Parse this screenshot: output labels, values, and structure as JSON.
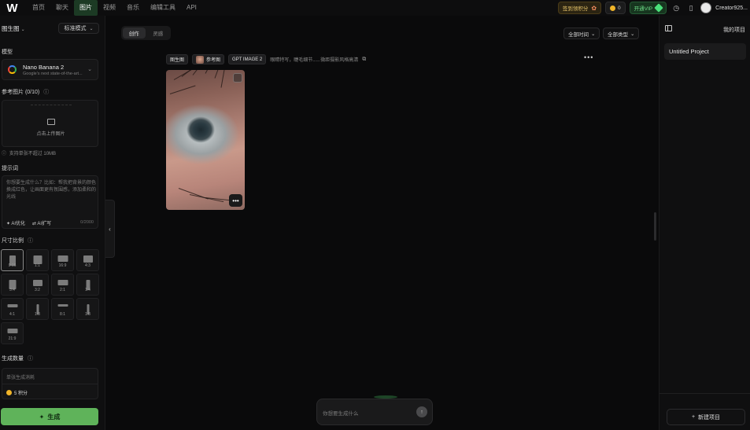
{
  "app": {
    "logo": "W"
  },
  "nav": {
    "items": [
      {
        "label": "首页"
      },
      {
        "label": "聊天"
      },
      {
        "label": "图片",
        "active": true
      },
      {
        "label": "视频"
      },
      {
        "label": "音乐"
      },
      {
        "label": "编辑工具"
      },
      {
        "label": "API"
      }
    ]
  },
  "topbar": {
    "promo_label": "签到领积分",
    "credits": "0",
    "vip_label": "开通VIP",
    "username": "Creator925..."
  },
  "left": {
    "mode_label": "图生图",
    "style_label": "标准模式",
    "model_section_label": "模型",
    "model_name": "Nano Banana 2",
    "model_sub": "Google's next state-of-the-art...",
    "ref_section_label": "参考图片 (0/10)",
    "upload_text": "点击上传图片",
    "upload_hint": "支持单张不超过 10MB",
    "prompt_section_label": "提示词",
    "prompt_placeholder": "你想要生成什么？比如：帮我把背景的颜色换成红色，让画面更有氛围感，添加柔和的光线",
    "prompt_tool_1": "AI优化",
    "prompt_tool_2": "AI扩写",
    "prompt_counter": "0/2000",
    "ratio_section_label": "尺寸比例",
    "ratios": [
      {
        "label": "9:16",
        "selected": true,
        "w": 8,
        "h": 13
      },
      {
        "label": "1:1",
        "w": 11,
        "h": 11
      },
      {
        "label": "16:9",
        "w": 13,
        "h": 8
      },
      {
        "label": "4:3",
        "w": 12,
        "h": 9
      },
      {
        "label": "3:4",
        "w": 9,
        "h": 12
      },
      {
        "label": "3:2",
        "w": 12,
        "h": 8
      },
      {
        "label": "2:1",
        "w": 13,
        "h": 7
      },
      {
        "label": "1:4",
        "w": 5,
        "h": 13
      },
      {
        "label": "4:1",
        "w": 13,
        "h": 4
      },
      {
        "label": "1:8",
        "w": 3,
        "h": 13
      },
      {
        "label": "8:1",
        "w": 13,
        "h": 3
      },
      {
        "label": "1:8",
        "w": 3,
        "h": 13
      },
      {
        "label": "21:9",
        "w": 13,
        "h": 6
      }
    ],
    "count_section_label": "生成数量",
    "count_placeholder": "单张生成消耗",
    "cost_label": "5 积分",
    "generate_label": "生成"
  },
  "center": {
    "segments": [
      {
        "label": "创作",
        "active": true
      },
      {
        "label": "灵感"
      }
    ],
    "filter_time": "全部时间",
    "filter_type": "全部类型",
    "result_tags": {
      "mode": "图生图",
      "ref": "参考图",
      "model": "GPT IMAGE 2"
    },
    "result_prompt": "眼睛特写，睫毛细节......微距摄影风格高清",
    "more_label": "•••",
    "chat_placeholder": "你想要生成什么"
  },
  "right": {
    "title": "我的项目",
    "project_name": "Untitled Project",
    "new_project_label": "新建项目"
  },
  "colors": {
    "accent_green": "#5fb35a",
    "nav_active": "#1c3a24",
    "background": "#0a0a0b"
  }
}
